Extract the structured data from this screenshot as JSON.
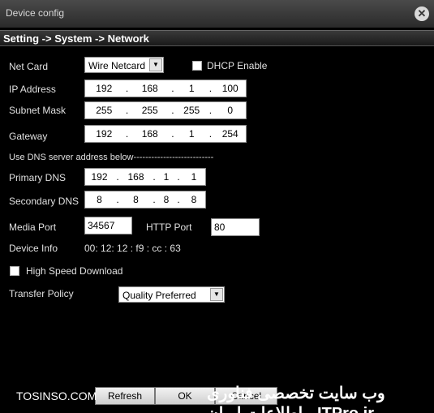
{
  "window": {
    "title": "Device config"
  },
  "breadcrumb": "Setting -> System -> Network",
  "net_card": {
    "label": "Net Card",
    "value": "Wire Netcard"
  },
  "dhcp": {
    "label": "DHCP Enable",
    "checked": false
  },
  "ip_address": {
    "label": "IP Address",
    "octets": [
      "192",
      "168",
      "1",
      "100"
    ]
  },
  "subnet_mask": {
    "label": "Subnet Mask",
    "octets": [
      "255",
      "255",
      "255",
      "0"
    ]
  },
  "gateway": {
    "label": "Gateway",
    "octets": [
      "192",
      "168",
      "1",
      "254"
    ]
  },
  "dns_heading": "Use DNS server address below---------------------------",
  "primary_dns": {
    "label": "Primary DNS",
    "octets": [
      "192",
      "168",
      "1",
      "1"
    ]
  },
  "secondary_dns": {
    "label": "Secondary DNS",
    "octets": [
      "8",
      "8",
      "8",
      "8"
    ]
  },
  "media_port": {
    "label": "Media Port",
    "value": "34567"
  },
  "http_port": {
    "label": "HTTP Port",
    "value": "80"
  },
  "device_info": {
    "label": "Device Info",
    "value": "00: 12: 12 : f9 : cc : 63"
  },
  "high_speed_download": {
    "label": "High Speed Download",
    "checked": false
  },
  "transfer_policy": {
    "label": "Transfer Policy",
    "value": "Quality Preferred"
  },
  "buttons": {
    "refresh": "Refresh",
    "ok": "OK",
    "cancel": "Cancel"
  },
  "watermark": {
    "left": "TOSINSO.COM",
    "right": "وب سایت تخصصی فناوری اطلاعات ایران - ITPro.ir"
  }
}
